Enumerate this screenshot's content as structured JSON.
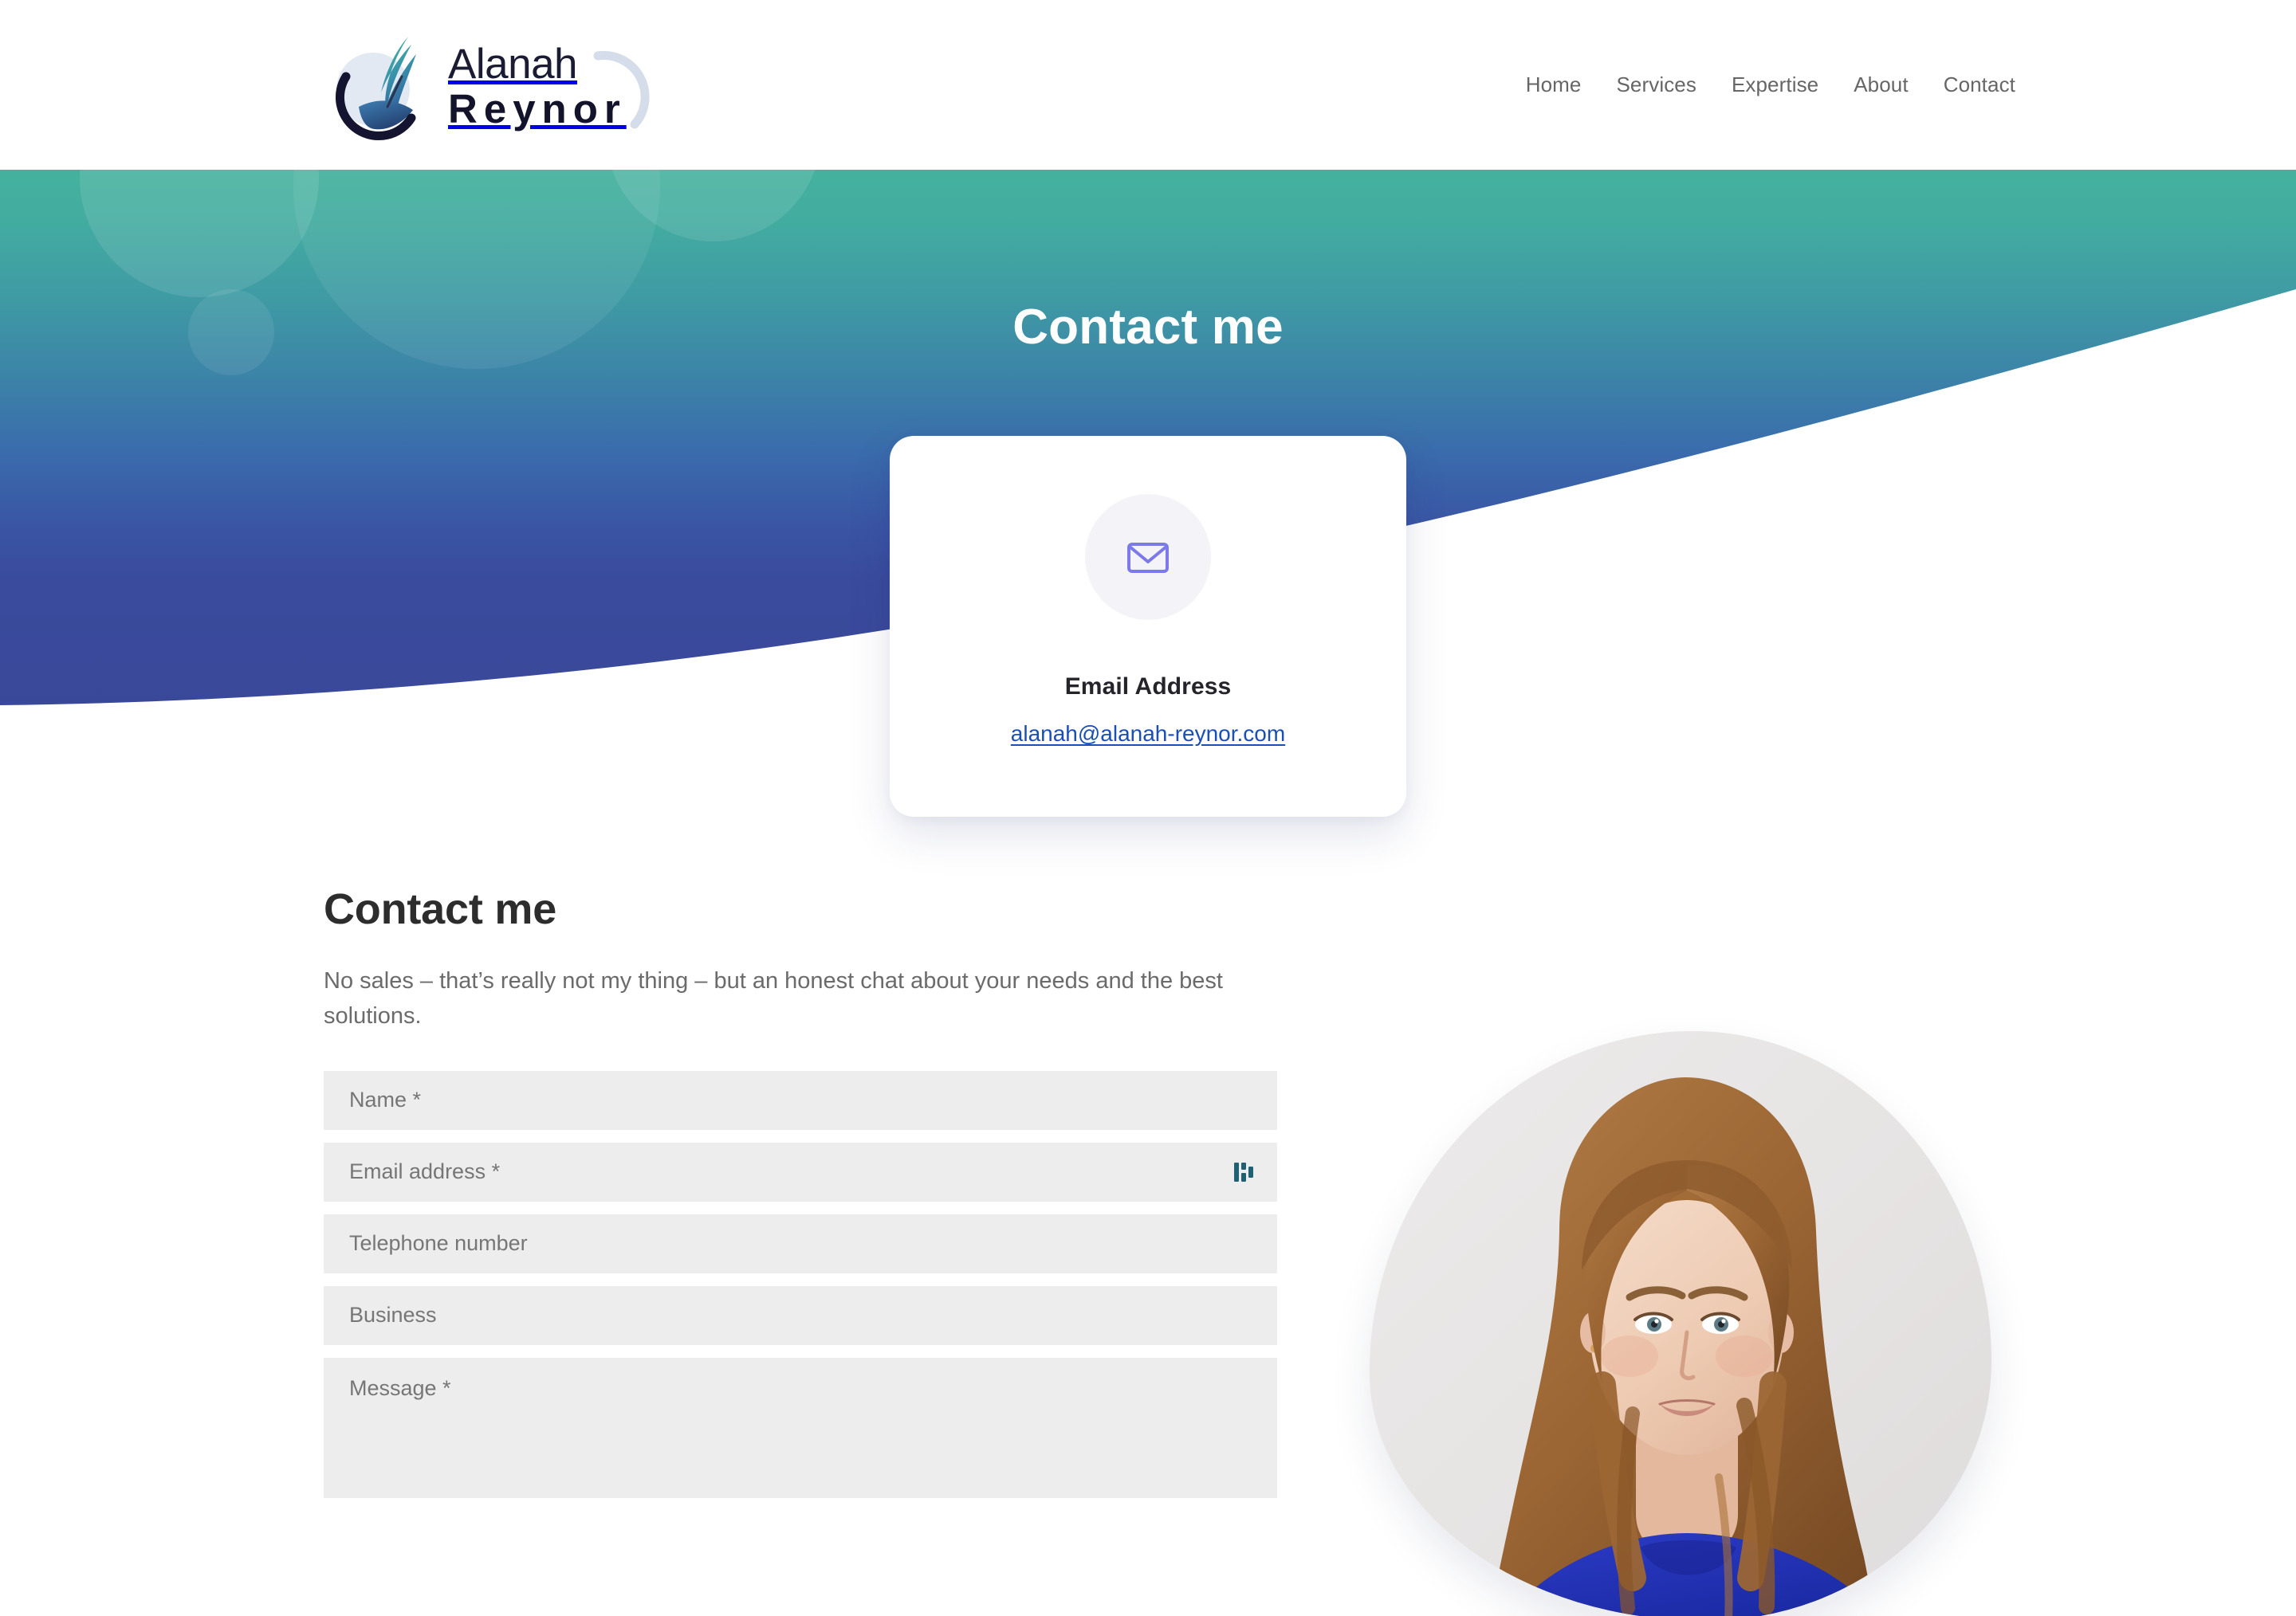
{
  "header": {
    "logo": {
      "line1": "Alanah",
      "line2": "Reynor",
      "mark_icon": "feather-quill-icon",
      "arc_icon": "arc-swoosh-icon"
    },
    "nav": [
      {
        "label": "Home"
      },
      {
        "label": "Services"
      },
      {
        "label": "Expertise"
      },
      {
        "label": "About"
      },
      {
        "label": "Contact"
      }
    ]
  },
  "hero": {
    "title": "Contact me",
    "colors": {
      "gradient_top": "#44b19e",
      "gradient_mid": "#3a6aac",
      "gradient_bottom": "#3a4899",
      "wave_dark": "#3a4899",
      "wave_mid": "#8d97d0",
      "wave_light": "#c7cce8"
    }
  },
  "email_card": {
    "icon": "envelope-icon",
    "icon_color": "#7b7ae8",
    "icon_bg": "#f4f4f8",
    "title": "Email Address",
    "email": "alanah@alanah-reynor.com",
    "link_color": "#1a4fb5"
  },
  "contact": {
    "title": "Contact me",
    "intro": "No sales – that’s really not my thing – but an honest chat about your needs and the best solutions.",
    "fields": [
      {
        "name": "name",
        "placeholder": "Name *",
        "value": "",
        "type": "text",
        "autofill_icon": false
      },
      {
        "name": "email",
        "placeholder": "Email address *",
        "value": "",
        "type": "email",
        "autofill_icon": true
      },
      {
        "name": "telephone",
        "placeholder": "Telephone number",
        "value": "",
        "type": "tel",
        "autofill_icon": false
      },
      {
        "name": "business",
        "placeholder": "Business",
        "value": "",
        "type": "text",
        "autofill_icon": false
      },
      {
        "name": "message",
        "placeholder": "Message *",
        "value": "",
        "type": "textarea",
        "autofill_icon": false
      }
    ],
    "field_bg": "#ededed",
    "autofill_icon_name": "password-manager-icon",
    "autofill_icon_color": "#1f6073"
  },
  "portrait": {
    "alt": "Portrait photo of Alanah Reynor",
    "shirt_color": "#2232b8",
    "backdrop_color": "#e8e6e6"
  }
}
